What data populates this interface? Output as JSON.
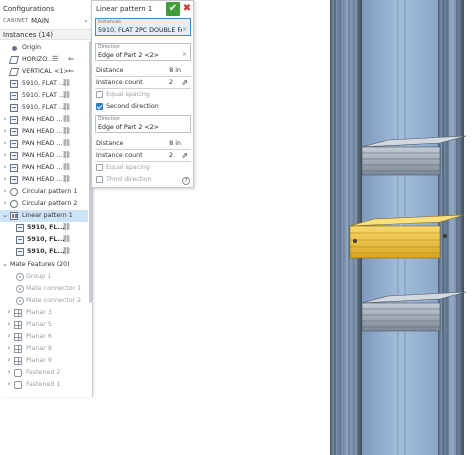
{
  "configurations": {
    "title": "Configurations",
    "cabinet_label": "CABINET",
    "cabinet_value": "MAIN"
  },
  "instances": {
    "header": "Instances (14)",
    "items": [
      {
        "label": "Origin",
        "icon": "origin-icon"
      },
      {
        "label": "HORIZO...",
        "icon": "plane-icon"
      },
      {
        "label": "VERTICAL <1>",
        "icon": "plane-icon"
      },
      {
        "label": "5910, FLAT ...",
        "icon": "part-icon"
      },
      {
        "label": "5910, FLAT ...",
        "icon": "part-icon"
      },
      {
        "label": "5910, FLAT ...",
        "icon": "part-icon"
      },
      {
        "label": "PAN HEAD ...",
        "icon": "part-icon"
      },
      {
        "label": "PAN HEAD ...",
        "icon": "part-icon"
      },
      {
        "label": "PAN HEAD ...",
        "icon": "part-icon"
      },
      {
        "label": "PAN HEAD ...",
        "icon": "part-icon"
      },
      {
        "label": "PAN HEAD ...",
        "icon": "part-icon"
      },
      {
        "label": "PAN HEAD ...",
        "icon": "part-icon"
      },
      {
        "label": "Circular pattern 1",
        "icon": "circular-pattern-icon"
      },
      {
        "label": "Circular pattern 2",
        "icon": "circular-pattern-icon"
      },
      {
        "label": "Linear pattern 1",
        "icon": "linear-pattern-icon"
      },
      {
        "label": "5910, FL...",
        "icon": "part-icon"
      },
      {
        "label": "5910, FL...",
        "icon": "part-icon"
      },
      {
        "label": "5910, FL...",
        "icon": "part-icon"
      }
    ]
  },
  "mate_features": {
    "header": "Mate Features (20)",
    "items": [
      {
        "label": "Group 1",
        "icon": "group-icon"
      },
      {
        "label": "Mate connector 1",
        "icon": "mate-connector-icon"
      },
      {
        "label": "Mate connector 2",
        "icon": "mate-connector-icon"
      },
      {
        "label": "Planar 3",
        "icon": "planar-mate-icon"
      },
      {
        "label": "Planar 5",
        "icon": "planar-mate-icon"
      },
      {
        "label": "Planar 6",
        "icon": "planar-mate-icon"
      },
      {
        "label": "Planar 8",
        "icon": "planar-mate-icon"
      },
      {
        "label": "Planar 9",
        "icon": "planar-mate-icon"
      },
      {
        "label": "Fastened 2",
        "icon": "fastened-mate-icon"
      },
      {
        "label": "Fastened 1",
        "icon": "fastened-mate-icon"
      }
    ]
  },
  "dialog": {
    "title": "Linear pattern 1",
    "instances_caption": "Instances",
    "instances_value": "5910, FLAT 2PC DOUBLE FA...",
    "direction1_caption": "Direction",
    "direction1_value": "Edge of Part 2 <2>",
    "distance1_label": "Distance",
    "distance1_value": "8 in",
    "count1_label": "Instance count",
    "count1_value": "2",
    "equal_spacing_label": "Equal spacing",
    "second_direction_label": "Second direction",
    "direction2_caption": "Direction",
    "direction2_value": "Edge of Part 2 <2>",
    "distance2_label": "Distance",
    "distance2_value": "8 in",
    "count2_label": "Instance count",
    "count2_value": "2",
    "equal_spacing2_label": "Equal spacing",
    "third_direction_label": "Third direction",
    "help": "?"
  },
  "colors": {
    "selection": "#cfe3f7",
    "ok_green": "#3f9d3a",
    "cancel_red": "#d0342c",
    "part_blue": "#8fb0d2",
    "highlight_yellow": "#f4c542"
  }
}
